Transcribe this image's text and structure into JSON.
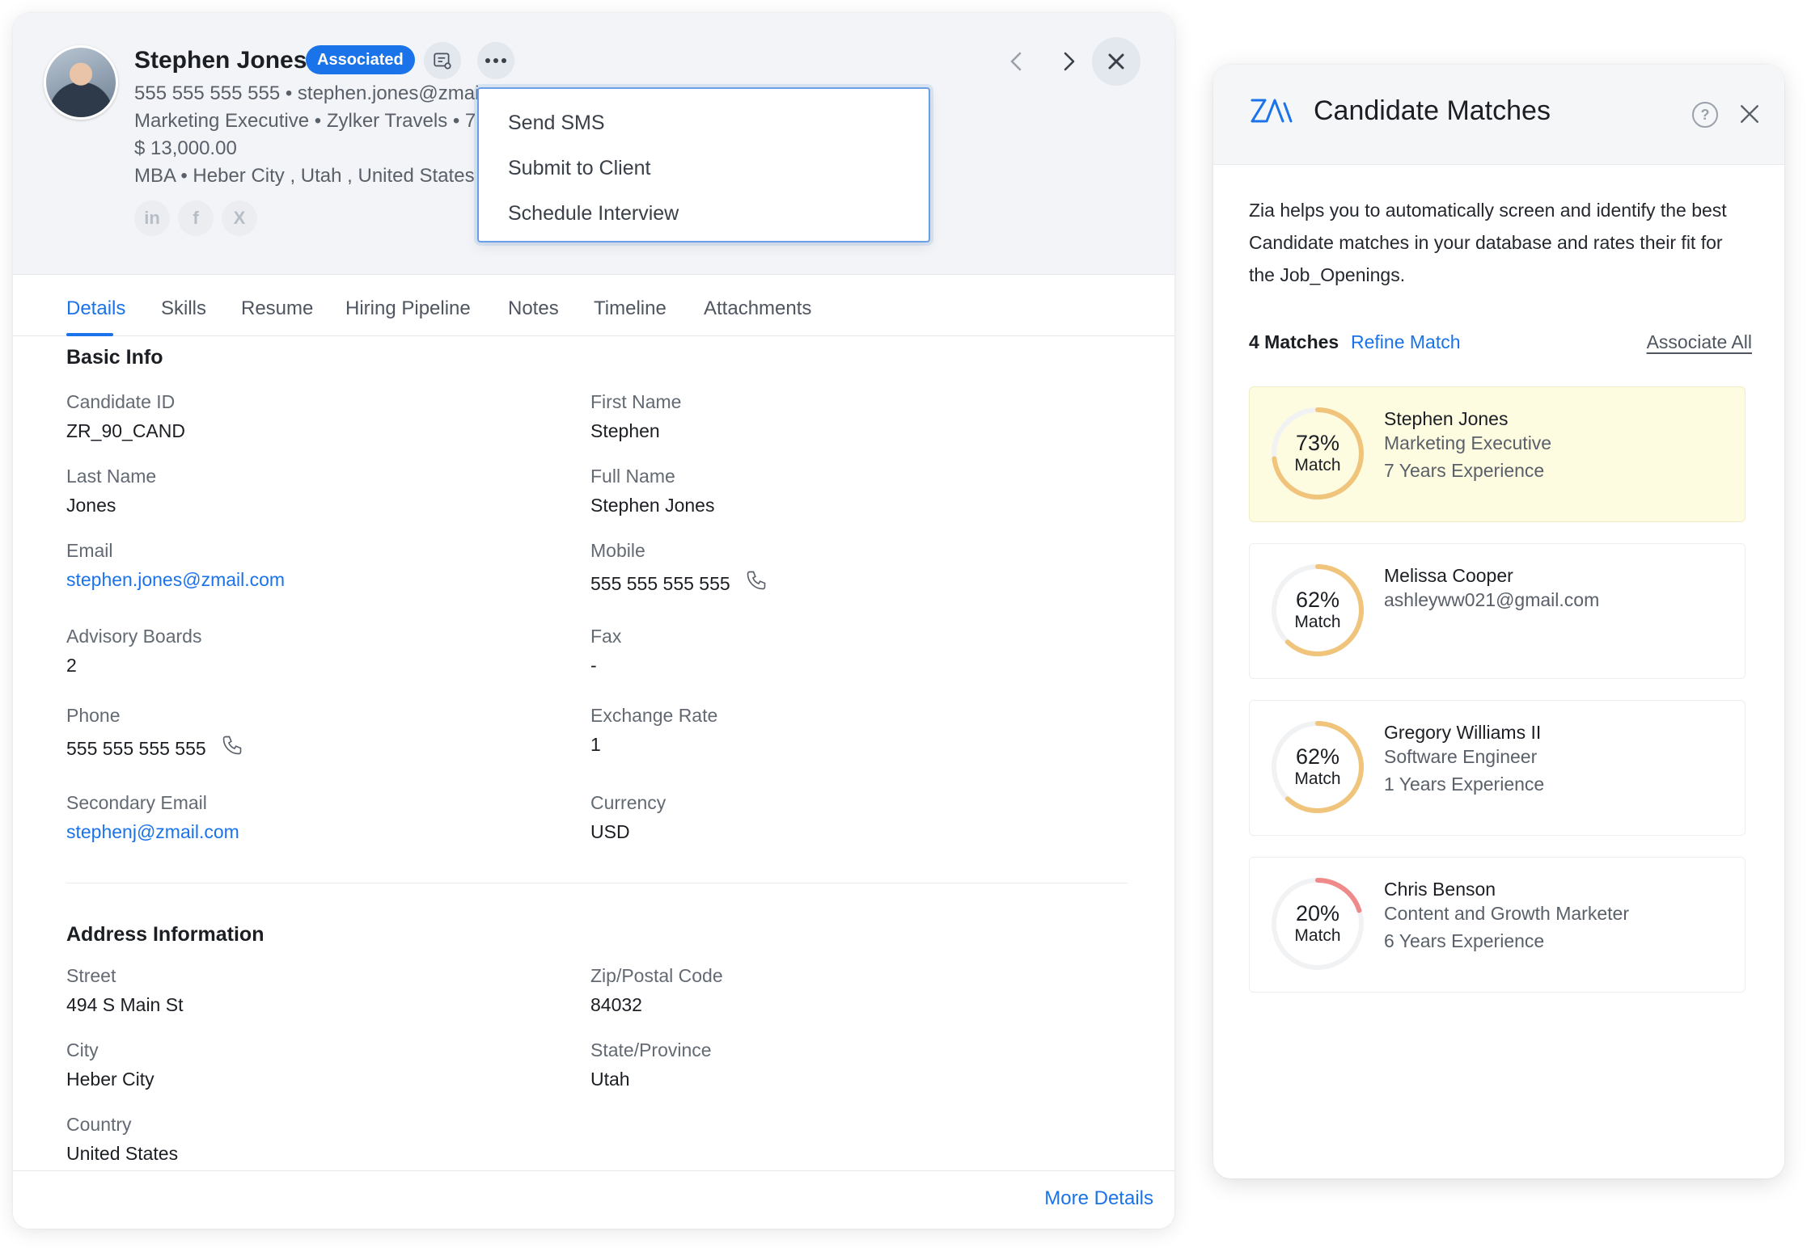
{
  "candidate": {
    "name": "Stephen Jones",
    "status": "Associated",
    "phone_email": "555 555 555 555 • stephen.jones@zmai",
    "title_company": "Marketing Executive • Zylker Travels • 7",
    "salary": "$ 13,000.00",
    "education_location": "MBA • Heber City , Utah , United States •",
    "social": [
      "in",
      "f",
      "X"
    ]
  },
  "menu": {
    "items": [
      "Send SMS",
      "Submit to Client",
      "Schedule Interview"
    ]
  },
  "tabs": [
    "Details",
    "Skills",
    "Resume",
    "Hiring Pipeline",
    "Notes",
    "Timeline",
    "Attachments"
  ],
  "basic_info": {
    "title": "Basic Info",
    "fields": [
      {
        "label": "Candidate ID",
        "value": "ZR_90_CAND"
      },
      {
        "label": "First Name",
        "value": "Stephen"
      },
      {
        "label": "Last Name",
        "value": "Jones"
      },
      {
        "label": "Full Name",
        "value": "Stephen Jones"
      },
      {
        "label": "Email",
        "value": "stephen.jones@zmail.com"
      },
      {
        "label": "Mobile",
        "value": "555 555 555 555"
      },
      {
        "label": "Advisory Boards",
        "value": "2"
      },
      {
        "label": "Fax",
        "value": "-"
      },
      {
        "label": "Phone",
        "value": "555 555 555 555"
      },
      {
        "label": "Exchange Rate",
        "value": "1"
      },
      {
        "label": "Secondary Email",
        "value": "stephenj@zmail.com"
      },
      {
        "label": "Currency",
        "value": "USD"
      }
    ]
  },
  "address": {
    "title": "Address Information",
    "fields": [
      {
        "label": "Street",
        "value": "494 S Main St"
      },
      {
        "label": "Zip/Postal Code",
        "value": "84032"
      },
      {
        "label": "City",
        "value": "Heber City"
      },
      {
        "label": "State/Province",
        "value": "Utah"
      },
      {
        "label": "Country",
        "value": "United States"
      }
    ]
  },
  "footer": {
    "more_details": "More Details"
  },
  "panel": {
    "title": "Candidate Matches",
    "help": "?",
    "description": "Zia helps you to automatically screen and identify the best Candidate matches in your database and rates their fit for the Job_Openings.",
    "matches_count": "4 Matches",
    "refine": "Refine Match",
    "associate_all": "Associate All",
    "match_label": "Match",
    "matches": [
      {
        "percent": 73,
        "percent_text": "73%",
        "name": "Stephen Jones",
        "line1": "Marketing Executive",
        "line2": "7 Years Experience",
        "color": "#f0c47a"
      },
      {
        "percent": 62,
        "percent_text": "62%",
        "name": "Melissa Cooper",
        "line1": "ashleyww021@gmail.com",
        "line2": "",
        "color": "#f0c47a"
      },
      {
        "percent": 62,
        "percent_text": "62%",
        "name": "Gregory Williams II",
        "line1": "Software Engineer",
        "line2": "1 Years Experience",
        "color": "#f0c47a"
      },
      {
        "percent": 20,
        "percent_text": "20%",
        "name": "Chris Benson",
        "line1": "Content and Growth Marketer",
        "line2": "6 Years Experience",
        "color": "#ee8a8a"
      }
    ]
  }
}
